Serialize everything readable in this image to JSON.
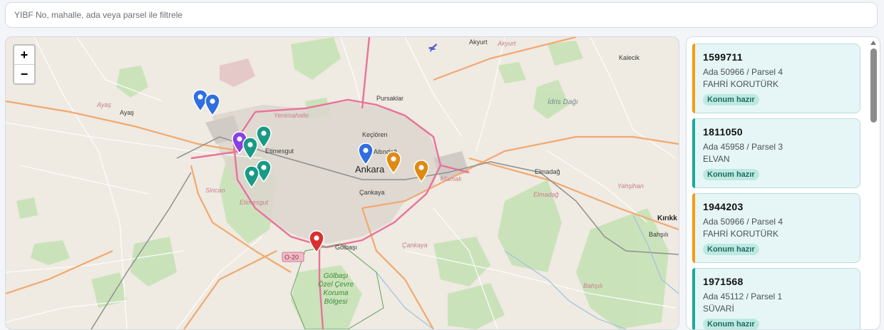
{
  "filter": {
    "placeholder": "YIBF No, mahalle, ada veya parsel ile filtrele"
  },
  "map": {
    "zoom_in": "+",
    "zoom_out": "−",
    "places": [
      {
        "key": "akyurt1",
        "text": "Akyurt"
      },
      {
        "key": "akyurt2",
        "text": "Akyurt"
      },
      {
        "key": "kalecik",
        "text": "Kalecik"
      },
      {
        "key": "ayas1",
        "text": "Ayaş"
      },
      {
        "key": "ayas2",
        "text": "Ayaş"
      },
      {
        "key": "pursaklar",
        "text": "Pursaklar"
      },
      {
        "key": "idris",
        "text": "İdris Dağı"
      },
      {
        "key": "yenimahalle",
        "text": "Yenimahalle"
      },
      {
        "key": "kecioren",
        "text": "Keçiören"
      },
      {
        "key": "etimesgut1",
        "text": "Etimesgut"
      },
      {
        "key": "altindag",
        "text": "Altındağ"
      },
      {
        "key": "ankara",
        "text": "Ankara"
      },
      {
        "key": "mamak",
        "text": "Mamak"
      },
      {
        "key": "elmadag1",
        "text": "Elmadağ"
      },
      {
        "key": "elmadag2",
        "text": "Elmadağ"
      },
      {
        "key": "yahsihan",
        "text": "Yahşihan"
      },
      {
        "key": "sincan",
        "text": "Sincan"
      },
      {
        "key": "cankaya1",
        "text": "Çankaya"
      },
      {
        "key": "etimesgut2",
        "text": "Etimesgut"
      },
      {
        "key": "kirikkale",
        "text": "Kırıkk"
      },
      {
        "key": "bahsili1",
        "text": "Bahşılı"
      },
      {
        "key": "golbasi",
        "text": "Gölbaşı"
      },
      {
        "key": "cankaya2",
        "text": "Çankaya"
      },
      {
        "key": "o20",
        "text": "O-20"
      },
      {
        "key": "park",
        "text": "Gölbaşı\nÖzel Çevre\nKoruma\nBölgesi"
      },
      {
        "key": "bahsili2",
        "text": "Bahşılı"
      }
    ]
  },
  "colors": {
    "orange": "#f39c12",
    "teal": "#1aaa9b",
    "pin_blue": "#2f6fe0",
    "pin_teal": "#199a86",
    "pin_purple": "#8a3fe0",
    "pin_orange": "#e08a12",
    "pin_red": "#d93030"
  },
  "parcels": [
    {
      "id": "1599711",
      "ada": "Ada 50966 / Parsel 4",
      "owner": "FAHRİ KORUTÜRK",
      "status": "Konum hazır",
      "accent": "#f39c12"
    },
    {
      "id": "1811050",
      "ada": "Ada 45958 / Parsel 3",
      "owner": "ELVAN",
      "status": "Konum hazır",
      "accent": "#1aaa9b"
    },
    {
      "id": "1944203",
      "ada": "Ada 50966 / Parsel 4",
      "owner": "FAHRİ KORUTÜRK",
      "status": "Konum hazır",
      "accent": "#f39c12"
    },
    {
      "id": "1971568",
      "ada": "Ada 45112 / Parsel 1",
      "owner": "SÜVARİ",
      "status": "Konum hazır",
      "accent": "#1aaa9b"
    }
  ]
}
